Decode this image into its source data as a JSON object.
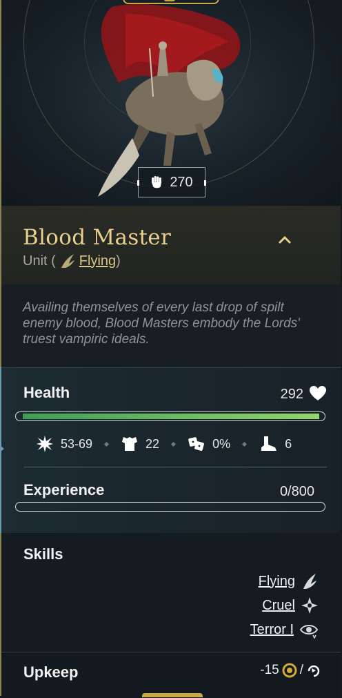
{
  "unit": {
    "power": "270",
    "name": "Blood Master",
    "type_prefix": "Unit (",
    "type_link": "Flying",
    "type_suffix": ")",
    "description": "Availing themselves of every last drop of spilt enemy blood, Blood Masters embody the Lords' truest vampiric ideals."
  },
  "health": {
    "label": "Health",
    "value": "292",
    "fraction": 1.0
  },
  "substats": {
    "damage": "53-69",
    "defense": "22",
    "chance": "0%",
    "movement": "6"
  },
  "experience": {
    "label": "Experience",
    "value": "0/800",
    "fraction": 0.0
  },
  "skills": {
    "label": "Skills",
    "items": [
      {
        "name": "Flying",
        "icon": "wing-icon"
      },
      {
        "name": "Cruel",
        "icon": "shuriken-icon"
      },
      {
        "name": "Terror I",
        "icon": "eye-swirl-icon"
      }
    ]
  },
  "upkeep": {
    "label": "Upkeep",
    "value": "-15",
    "separator": "/"
  },
  "colors": {
    "gold": "#e8cf8e",
    "health_bar": "#7fcf66",
    "accent_edge": "#6a9bb0"
  }
}
